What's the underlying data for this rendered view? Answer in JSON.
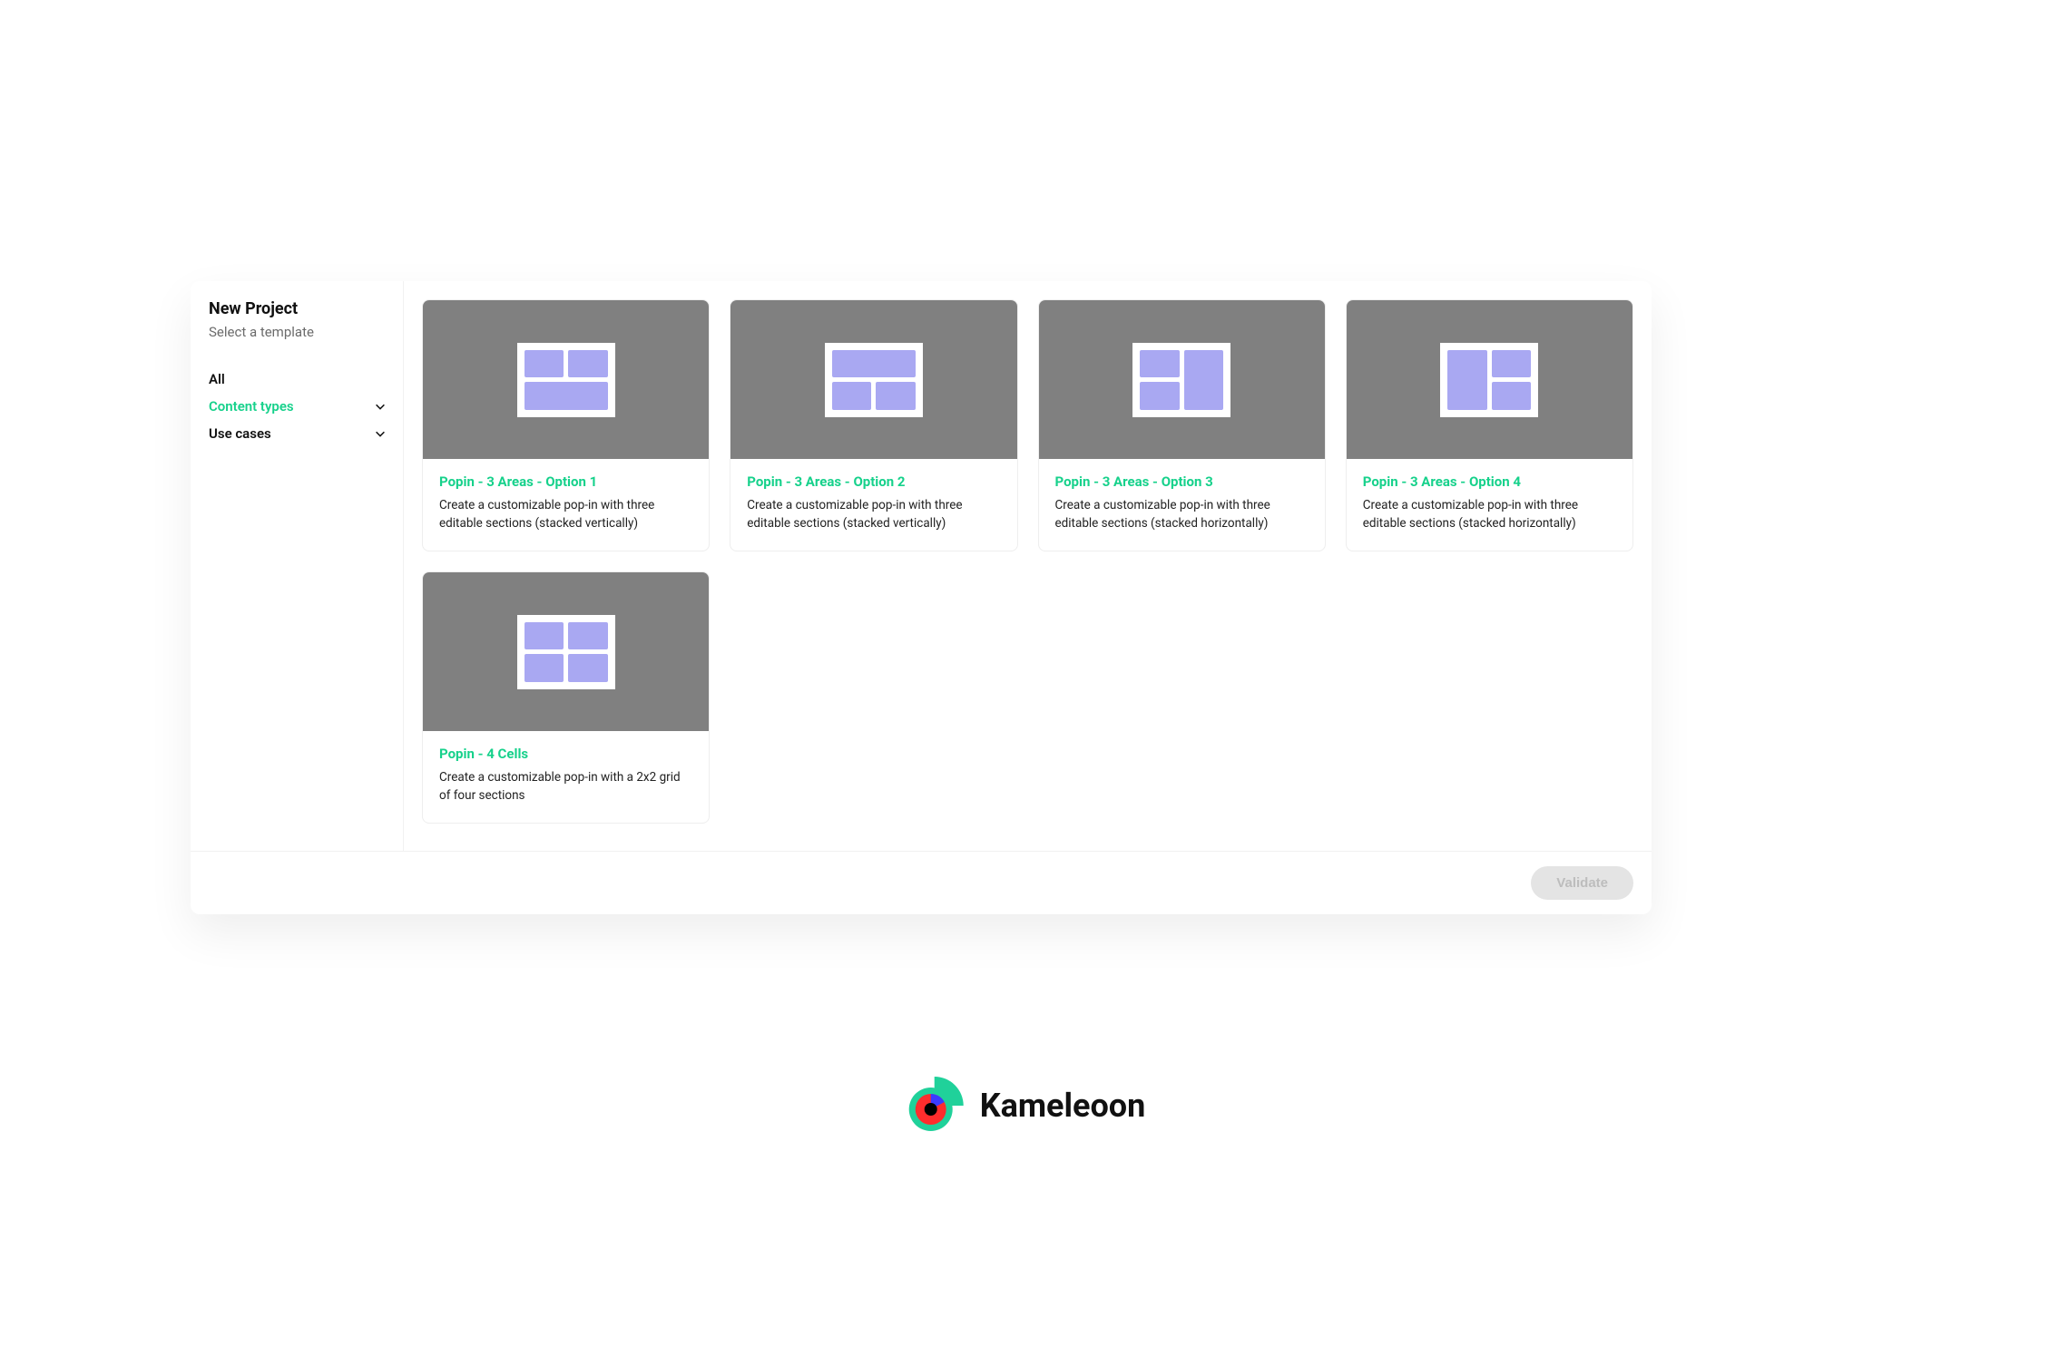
{
  "colors": {
    "accent": "#16d18b",
    "thumb_bg": "#808080",
    "thumb_cell": "#a9a8f2",
    "btn_bg": "#e4e4e4",
    "btn_text": "#bdbdbd"
  },
  "sidebar": {
    "title": "New Project",
    "subtitle": "Select a template",
    "filters": [
      {
        "label": "All",
        "expandable": false,
        "active": false
      },
      {
        "label": "Content types",
        "expandable": true,
        "active": true
      },
      {
        "label": "Use cases",
        "expandable": true,
        "active": false
      }
    ]
  },
  "templates": [
    {
      "title": "Popin - 3 Areas - Option 1",
      "description": "Create a customizable pop-in with three editable sections (stacked vertically)",
      "layout": {
        "cols": "1fr 1fr",
        "rows": "1fr 1fr",
        "cells": [
          {
            "col": "1 / 2",
            "row": "1 / 2"
          },
          {
            "col": "2 / 3",
            "row": "1 / 2"
          },
          {
            "col": "1 / 3",
            "row": "2 / 3"
          }
        ]
      }
    },
    {
      "title": "Popin - 3 Areas - Option 2",
      "description": "Create a customizable pop-in with three editable sections (stacked vertically)",
      "layout": {
        "cols": "1fr 1fr",
        "rows": "1fr 1fr",
        "cells": [
          {
            "col": "1 / 3",
            "row": "1 / 2"
          },
          {
            "col": "1 / 2",
            "row": "2 / 3"
          },
          {
            "col": "2 / 3",
            "row": "2 / 3"
          }
        ]
      }
    },
    {
      "title": "Popin - 3 Areas - Option 3",
      "description": "Create a customizable pop-in with three editable sections (stacked horizontally)",
      "layout": {
        "cols": "1fr 1fr",
        "rows": "1fr 1fr",
        "cells": [
          {
            "col": "1 / 2",
            "row": "1 / 2"
          },
          {
            "col": "1 / 2",
            "row": "2 / 3"
          },
          {
            "col": "2 / 3",
            "row": "1 / 3"
          }
        ]
      }
    },
    {
      "title": "Popin - 3 Areas - Option 4",
      "description": "Create a customizable pop-in with three editable sections (stacked horizontally)",
      "layout": {
        "cols": "1fr 1fr",
        "rows": "1fr 1fr",
        "cells": [
          {
            "col": "1 / 2",
            "row": "1 / 3"
          },
          {
            "col": "2 / 3",
            "row": "1 / 2"
          },
          {
            "col": "2 / 3",
            "row": "2 / 3"
          }
        ]
      }
    },
    {
      "title": "Popin - 4 Cells",
      "description": "Create a customizable pop-in with a 2x2 grid of four sections",
      "layout": {
        "cols": "1fr 1fr",
        "rows": "1fr 1fr",
        "cells": [
          {
            "col": "1 / 2",
            "row": "1 / 2"
          },
          {
            "col": "2 / 3",
            "row": "1 / 2"
          },
          {
            "col": "1 / 2",
            "row": "2 / 3"
          },
          {
            "col": "2 / 3",
            "row": "2 / 3"
          }
        ]
      }
    }
  ],
  "footer": {
    "validate_label": "Validate"
  },
  "brand": {
    "name": "Kameleoon"
  }
}
